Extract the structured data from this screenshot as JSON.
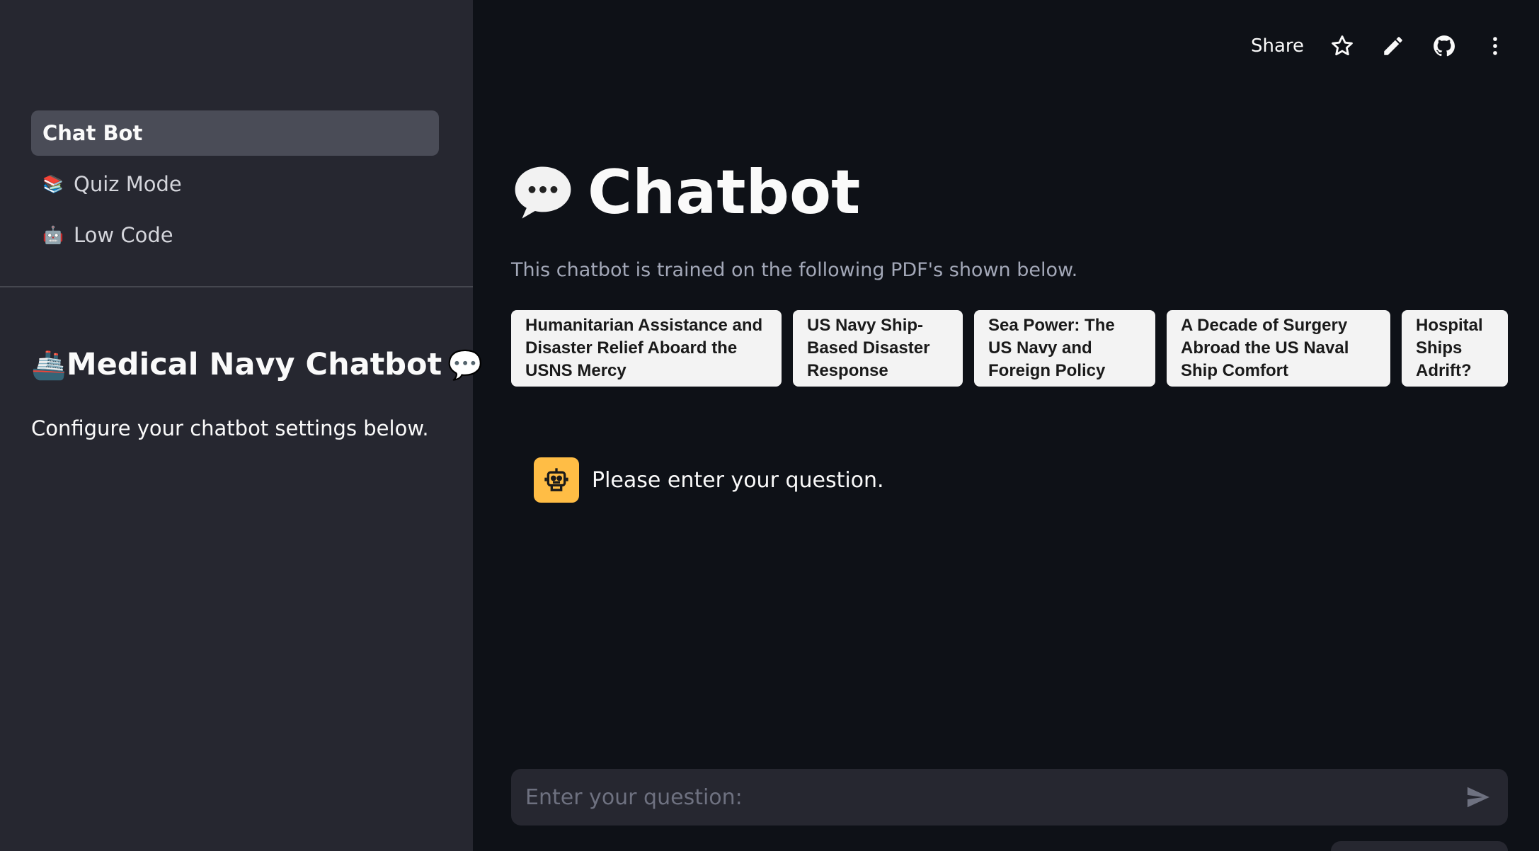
{
  "sidebar": {
    "nav": [
      {
        "label": "Chat Bot",
        "emoji": "",
        "active": true
      },
      {
        "label": "Quiz Mode",
        "emoji": "📚",
        "active": false
      },
      {
        "label": "Low Code",
        "emoji": "🤖",
        "active": false
      }
    ],
    "title_prefix_emoji": "🚢",
    "title": "Medical Navy Chatbot",
    "title_suffix_emoji": "💬",
    "subtitle": "Configure your chatbot settings below."
  },
  "toolbar": {
    "share_label": "Share",
    "icons": [
      "star-icon",
      "pencil-icon",
      "github-icon",
      "more-vertical-icon"
    ]
  },
  "main": {
    "title": "Chatbot",
    "description": "This chatbot is trained on the following PDF's shown below.",
    "pdfs": [
      "Humanitarian Assistance and Disaster Relief Aboard the USNS Mercy",
      "US Navy Ship-Based Disaster Response",
      "Sea Power: The US Navy and Foreign Policy",
      "A Decade of Surgery Abroad the US Naval Ship Comfort",
      "Hospital Ships Adrift?"
    ],
    "message": "Please enter your question.",
    "input_placeholder": "Enter your question:"
  },
  "colors": {
    "background": "#0e1117",
    "sidebar": "#262730",
    "avatar": "#ffbd45"
  }
}
